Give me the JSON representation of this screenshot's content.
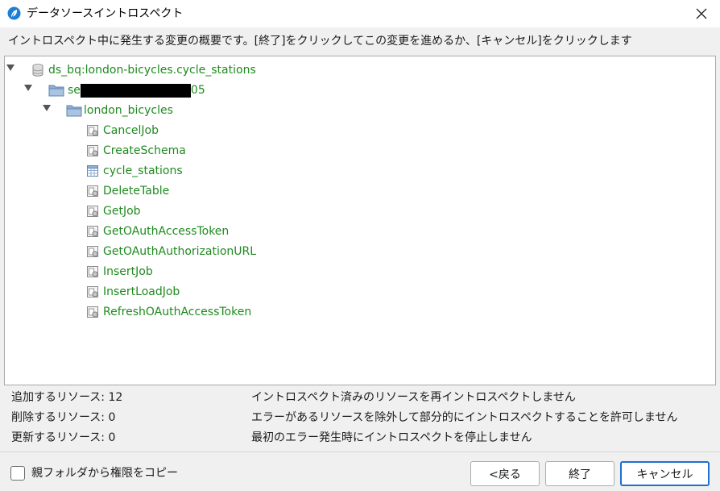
{
  "window": {
    "title": "データソースイントロスペクト",
    "app_icon": "feather-icon",
    "close_icon": "close-icon"
  },
  "description": "イントロスペクト中に発生する変更の概要です。[終了]をクリックしてこの変更を進めるか、[キャンセル]をクリックします",
  "tree": {
    "root": {
      "label": "ds_bq:london-bicycles.cycle_stations",
      "icon": "database-icon",
      "expanded": true
    },
    "project": {
      "label_prefix": "se",
      "label_suffix": "05",
      "icon": "folder-icon",
      "expanded": true
    },
    "dataset": {
      "label": "london_bicycles",
      "icon": "folder-icon",
      "expanded": true
    },
    "items": [
      {
        "label": "CancelJob",
        "icon": "procedure-icon"
      },
      {
        "label": "CreateSchema",
        "icon": "procedure-icon"
      },
      {
        "label": "cycle_stations",
        "icon": "table-icon"
      },
      {
        "label": "DeleteTable",
        "icon": "procedure-icon"
      },
      {
        "label": "GetJob",
        "icon": "procedure-icon"
      },
      {
        "label": "GetOAuthAccessToken",
        "icon": "procedure-icon"
      },
      {
        "label": "GetOAuthAuthorizationURL",
        "icon": "procedure-icon"
      },
      {
        "label": "InsertJob",
        "icon": "procedure-icon"
      },
      {
        "label": "InsertLoadJob",
        "icon": "procedure-icon"
      },
      {
        "label": "RefreshOAuthAccessToken",
        "icon": "procedure-icon"
      }
    ],
    "label_color": "#1f8a1f"
  },
  "summary": {
    "added": "追加するリソース: 12",
    "deleted": "削除するリソース: 0",
    "updated": "更新するリソース: 0",
    "note_reintrospect": "イントロスペクト済みのリソースを再イントロスペクトしません",
    "note_partial": "エラーがあるリソースを除外して部分的にイントロスペクトすることを許可しません",
    "note_stop": "最初のエラー発生時にイントロスペクトを停止しません"
  },
  "footer": {
    "copy_permissions_label": "親フォルダから権限をコピー",
    "copy_permissions_checked": false,
    "back_button": "<戻る",
    "finish_button": "終了",
    "cancel_button": "キャンセル"
  },
  "colors": {
    "accent": "#1e6fd0",
    "tree_text": "#1f8a1f"
  }
}
